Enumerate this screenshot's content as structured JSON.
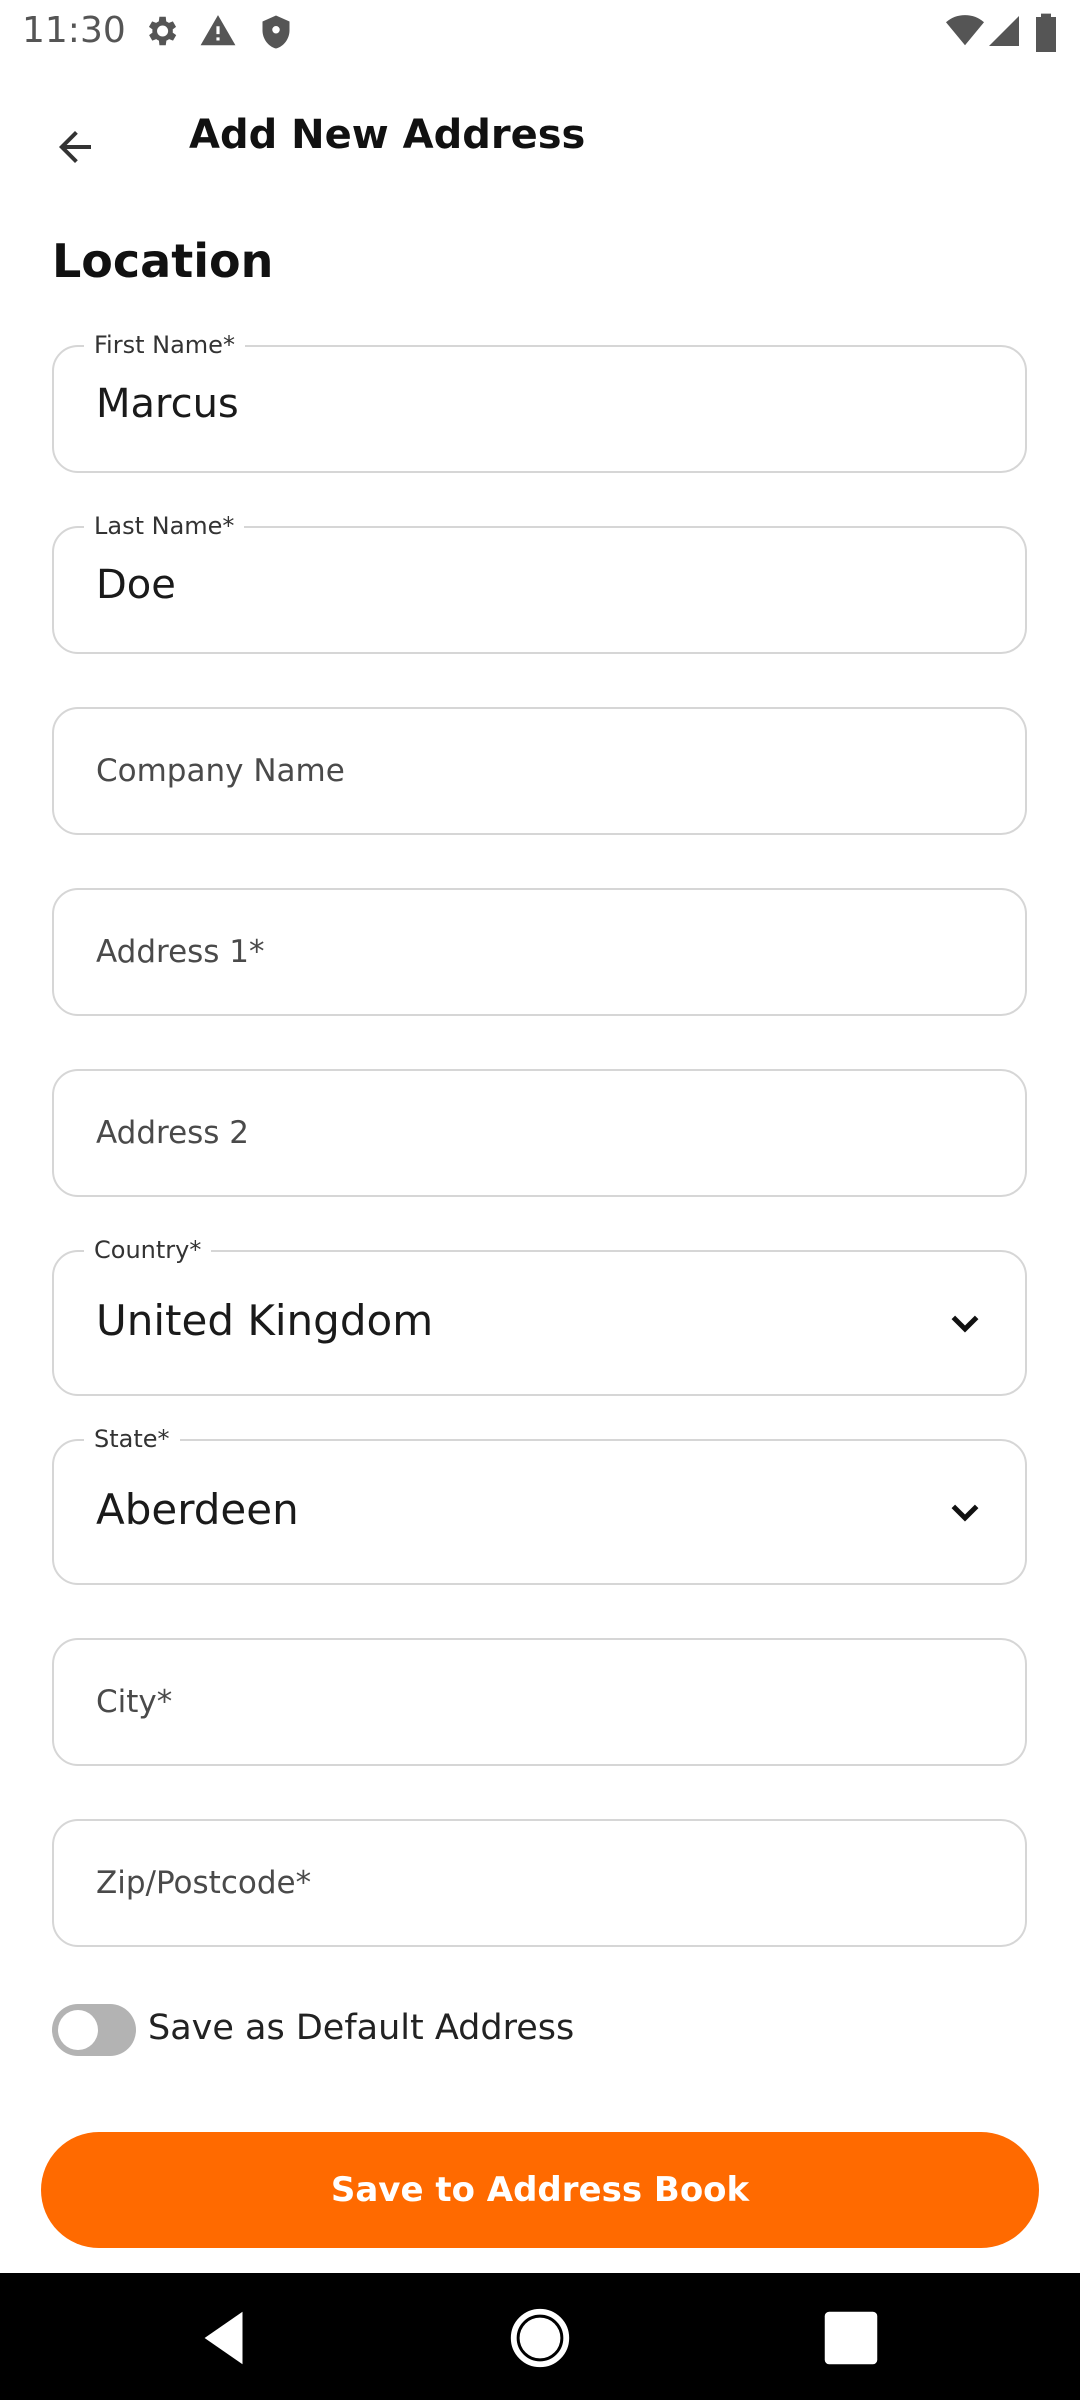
{
  "status_bar": {
    "time": "11:30",
    "left_icons": [
      "gear-icon",
      "warning-icon",
      "shield-icon"
    ],
    "right_icons": [
      "wifi-icon",
      "signal-icon",
      "battery-icon"
    ]
  },
  "header": {
    "back_icon": "arrow-left-icon",
    "title": "Add New Address"
  },
  "section": {
    "title": "Location"
  },
  "form": {
    "first_name": {
      "label": "First Name*",
      "value": "Marcus"
    },
    "last_name": {
      "label": "Last Name*",
      "value": "Doe"
    },
    "company": {
      "placeholder": "Company Name"
    },
    "address1": {
      "placeholder": "Address 1*"
    },
    "address2": {
      "placeholder": "Address 2"
    },
    "country": {
      "label": "Country*",
      "value": "United Kingdom"
    },
    "state": {
      "label": "State*",
      "value": "Aberdeen"
    },
    "city": {
      "placeholder": "City*"
    },
    "zip": {
      "placeholder": "Zip/Postcode*"
    },
    "default_toggle": {
      "label": "Save as Default Address",
      "checked": false
    }
  },
  "actions": {
    "save_label": "Save to Address Book"
  },
  "colors": {
    "accent": "#ff6a00",
    "field_border": "#d6d6d6",
    "toggle_off": "#b3b3b3",
    "nav_bar": "#000000"
  },
  "nav_bar": {
    "icons": [
      "back-triangle-icon",
      "home-circle-icon",
      "recents-square-icon"
    ]
  }
}
